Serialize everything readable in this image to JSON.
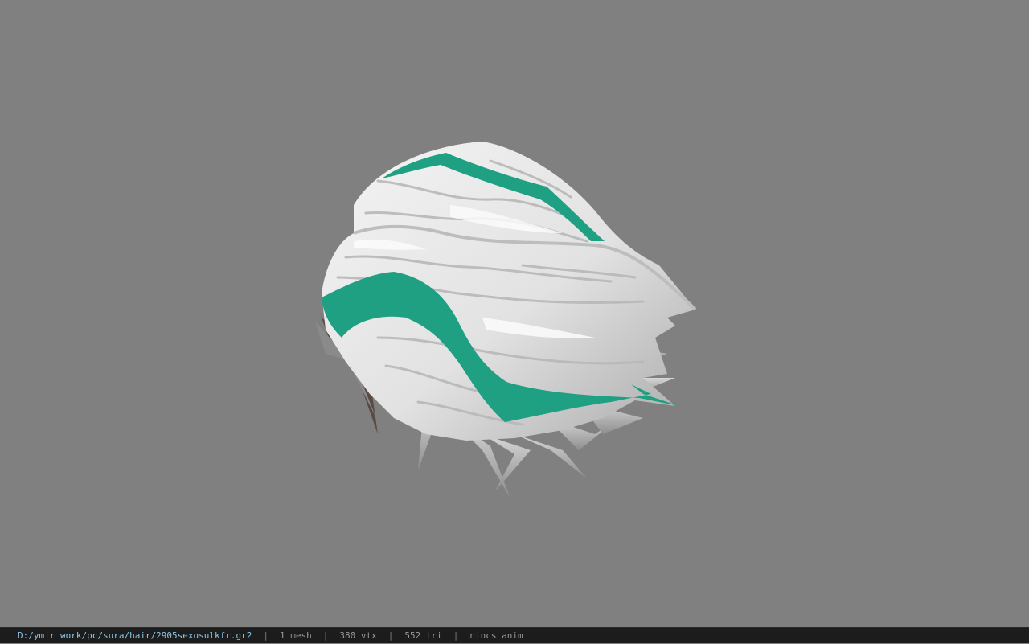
{
  "status_bar": {
    "file_path": "D:/ymir work/pc/sura/hair/2905sexosulkfr.gr2",
    "separator": "|",
    "mesh_count": "1 mesh",
    "vertex_count": "380 vtx",
    "triangle_count": "552 tri",
    "animation": "nincs anim"
  },
  "colors": {
    "background": "#808080",
    "hair_base": "#e8e8e8",
    "hair_stripe": "#1fa082",
    "status_bar_bg": "#1c1c1c",
    "path_text": "#8ec6e8"
  }
}
